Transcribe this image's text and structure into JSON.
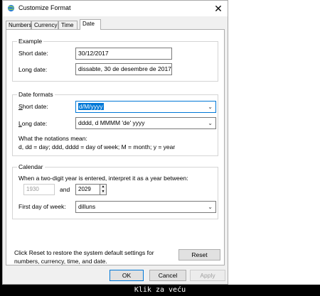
{
  "window": {
    "title": "Customize Format",
    "close_glyph": "✕"
  },
  "tabs": [
    {
      "label": "Numbers",
      "active": false
    },
    {
      "label": "Currency",
      "active": false
    },
    {
      "label": "Time",
      "active": false
    },
    {
      "label": "Date",
      "active": true
    }
  ],
  "example": {
    "group_title": "Example",
    "short_label": "Short date:",
    "short_value": "30/12/2017",
    "long_label": "Long date:",
    "long_value": "dissabte, 30 de desembre de 2017"
  },
  "formats": {
    "group_title": "Date formats",
    "short_label": "Short date:",
    "short_value": "d/M/yyyy",
    "long_label": "Long date:",
    "long_value": "dddd, d MMMM 'de' yyyy",
    "notations_title": "What the notations mean:",
    "notations_text": "d, dd = day;  ddd, dddd = day of week;  M = month;  y = year"
  },
  "calendar": {
    "group_title": "Calendar",
    "two_digit_text": "When a two-digit year is entered, interpret it as a year between:",
    "year_start": "1930",
    "and_label": "and",
    "year_end": "2029",
    "first_day_label": "First day of week:",
    "first_day_value": "dilluns"
  },
  "reset": {
    "text_line1": "Click Reset to restore the system default settings for",
    "text_line2": "numbers, currency, time, and date.",
    "button_label": "Reset"
  },
  "footer": {
    "ok_label": "OK",
    "cancel_label": "Cancel",
    "apply_label": "Apply"
  },
  "caption": "Klik za veću"
}
